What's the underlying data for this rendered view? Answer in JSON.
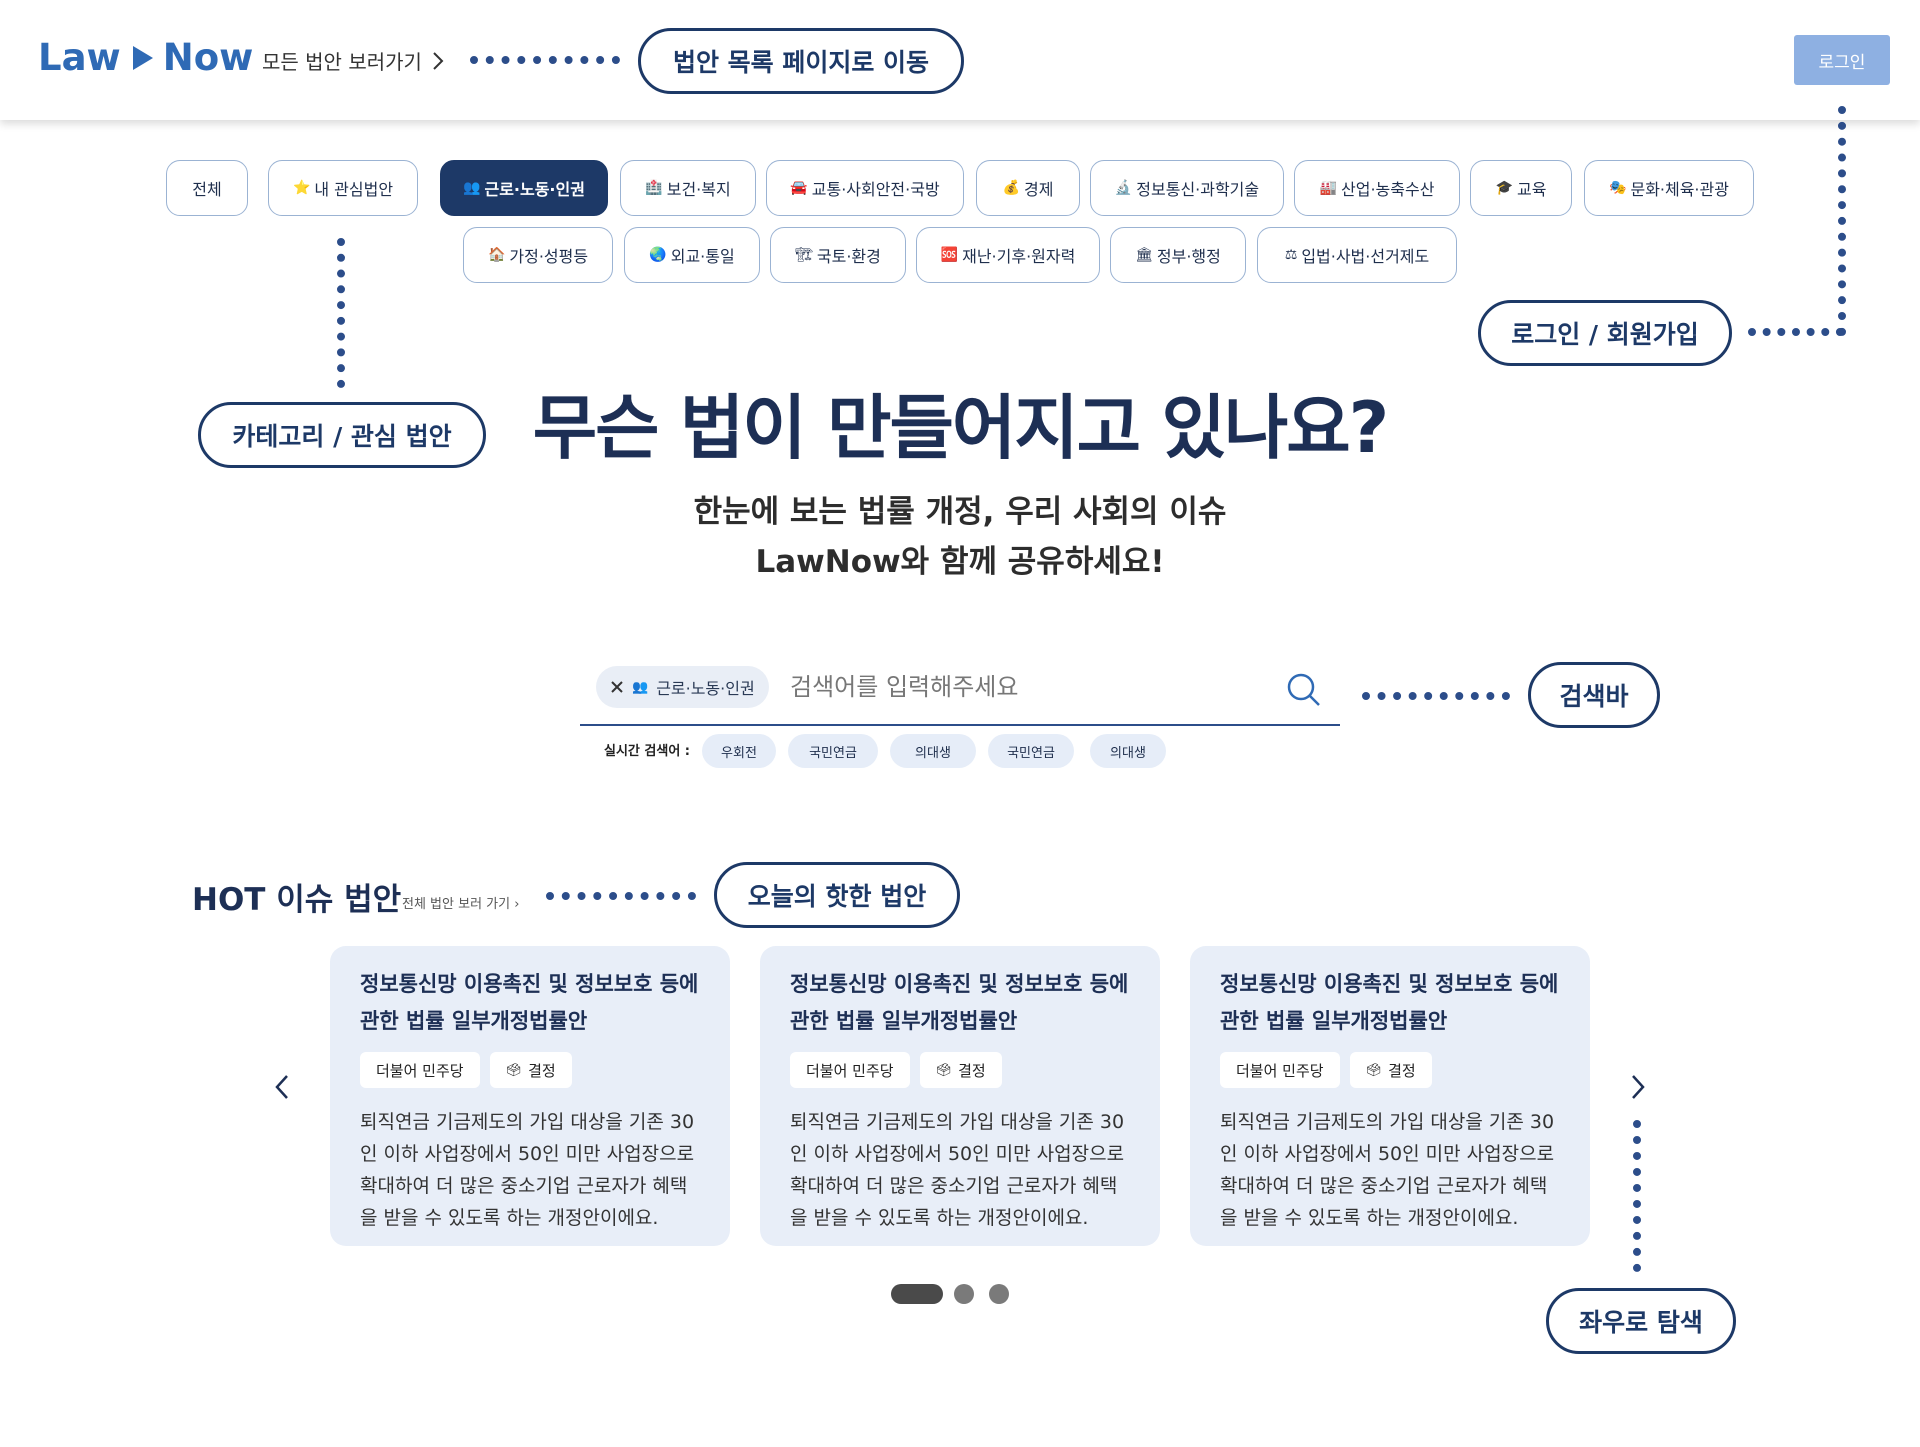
{
  "header": {
    "logo_left": "Law",
    "logo_right": "Now",
    "all_bills_link": "모든 법안 보러가기",
    "login_button": "로그인"
  },
  "callouts": {
    "bill_list": "법안 목록 페이지로 이동",
    "login_signup": "로그인 / 회원가입",
    "category": "카테고리 / 관심 법안",
    "search_bar": "검색바",
    "hot_bills": "오늘의 핫한 법안",
    "browse": "좌우로 탐색"
  },
  "categories": {
    "row1": [
      {
        "icon": "",
        "label": "전체"
      },
      {
        "icon": "⭐",
        "label": "내 관심법안"
      },
      {
        "icon": "👥",
        "label": "근로·노동·인권"
      },
      {
        "icon": "🏥",
        "label": "보건·복지"
      },
      {
        "icon": "🚘",
        "label": "교통·사회안전·국방"
      },
      {
        "icon": "💰",
        "label": "경제"
      },
      {
        "icon": "🔬",
        "label": "정보통신·과학기술"
      },
      {
        "icon": "🏭",
        "label": "산업·농축수산"
      },
      {
        "icon": "🎓",
        "label": "교육"
      },
      {
        "icon": "🎭",
        "label": "문화·체육·관광"
      }
    ],
    "row2": [
      {
        "icon": "🏠",
        "label": "가정·성평등"
      },
      {
        "icon": "🌏",
        "label": "외교·통일"
      },
      {
        "icon": "🏗",
        "label": "국토·환경"
      },
      {
        "icon": "🆘",
        "label": "재난·기후·원자력"
      },
      {
        "icon": "🏛",
        "label": "정부·행정"
      },
      {
        "icon": "⚖",
        "label": "입법·사법·선거제도"
      }
    ]
  },
  "hero": {
    "title": "무슨 법이 만들어지고 있나요?",
    "subtitle_line1": "한눈에 보는 법률 개정, 우리 사회의 이슈",
    "subtitle_line2": "LawNow와 함께 공유하세요!"
  },
  "search": {
    "tag_icon": "👥",
    "tag_label": "근로·노동·인권",
    "placeholder": "검색어를 입력해주세요",
    "trending_label": "실시간 검색어 :",
    "trending": [
      "우회전",
      "국민연금",
      "의대생",
      "국민연금",
      "의대생"
    ]
  },
  "hot": {
    "title": "HOT 이슈 법안",
    "link": "전체 법안 보러 가기",
    "cards": [
      {
        "title": "정보통신망 이용촉진 및 정보보호 등에 관한 법률 일부개정법률안",
        "party": "더불어 민주당",
        "status_icon": "🗳",
        "status": "결정",
        "desc": "퇴직연금 기금제도의 가입 대상을 기존 30인 이하 사업장에서 50인 미만 사업장으로 확대하여 더 많은 중소기업 근로자가 혜택을 받을 수 있도록 하는 개정안이에요."
      },
      {
        "title": "정보통신망 이용촉진 및 정보보호 등에 관한 법률 일부개정법률안",
        "party": "더불어 민주당",
        "status_icon": "🗳",
        "status": "결정",
        "desc": "퇴직연금 기금제도의 가입 대상을 기존 30인 이하 사업장에서 50인 미만 사업장으로 확대하여 더 많은 중소기업 근로자가 혜택을 받을 수 있도록 하는 개정안이에요."
      },
      {
        "title": "정보통신망 이용촉진 및 정보보호 등에 관한 법률 일부개정법률안",
        "party": "더불어 민주당",
        "status_icon": "🗳",
        "status": "결정",
        "desc": "퇴직연금 기금제도의 가입 대상을 기존 30인 이하 사업장에서 50인 미만 사업장으로 확대하여 더 많은 중소기업 근로자가 혜택을 받을 수 있도록 하는 개정안이에요."
      }
    ],
    "carousel_pages": 3,
    "carousel_active": 1
  },
  "colors": {
    "primary": "#1d3967",
    "accent": "#2f6ab5",
    "login_button": "#8eb0e2",
    "card_bg": "#e8eef8"
  }
}
